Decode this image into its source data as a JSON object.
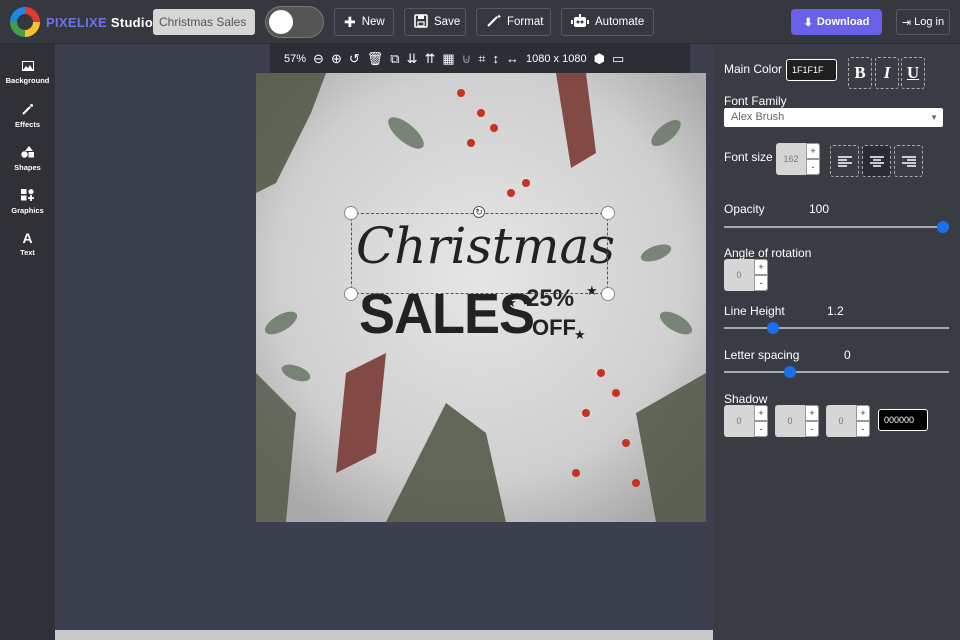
{
  "header": {
    "brand": "PIXELIXE",
    "studio": "Studio",
    "project_name": "Christmas Sales",
    "new_label": "New",
    "save_label": "Save",
    "format_label": "Format",
    "automate_label": "Automate",
    "download_label": "Download",
    "login_label": "Log in"
  },
  "sidebar": {
    "items": [
      {
        "label": "Background",
        "icon": "image-icon"
      },
      {
        "label": "Effects",
        "icon": "magic-wand-icon"
      },
      {
        "label": "Shapes",
        "icon": "shapes-icon"
      },
      {
        "label": "Graphics",
        "icon": "graphics-icon"
      },
      {
        "label": "Text",
        "icon": "text-icon"
      }
    ]
  },
  "canvas_toolbar": {
    "zoom": "57%",
    "size": "1080 x 1080"
  },
  "artwork": {
    "headline": "Christmas",
    "subhead": "SALES",
    "discount": "25%",
    "off": "OFF"
  },
  "panel": {
    "main_color_label": "Main Color",
    "main_color_value": "1F1F1F",
    "font_family_label": "Font Family",
    "font_family_value": "Alex Brush",
    "font_size_label": "Font size",
    "font_size_value": "162",
    "opacity_label": "Opacity",
    "opacity_value": "100",
    "opacity_level": 1.0,
    "rotation_label": "Angle of rotation",
    "rotation_value": "0",
    "line_height_label": "Line Height",
    "line_height_value": "1.2",
    "line_height_level": 0.2,
    "letter_spacing_label": "Letter spacing",
    "letter_spacing_value": "0",
    "letter_spacing_level": 0.28,
    "shadow_label": "Shadow",
    "shadow_x": "0",
    "shadow_y": "0",
    "shadow_blur": "0",
    "shadow_color": "000000",
    "bold": "B",
    "italic": "I",
    "underline": "U",
    "plus": "+",
    "minus": "-"
  },
  "colors": {
    "accent": "#6860e6",
    "slider_thumb": "#1a6ff0"
  }
}
